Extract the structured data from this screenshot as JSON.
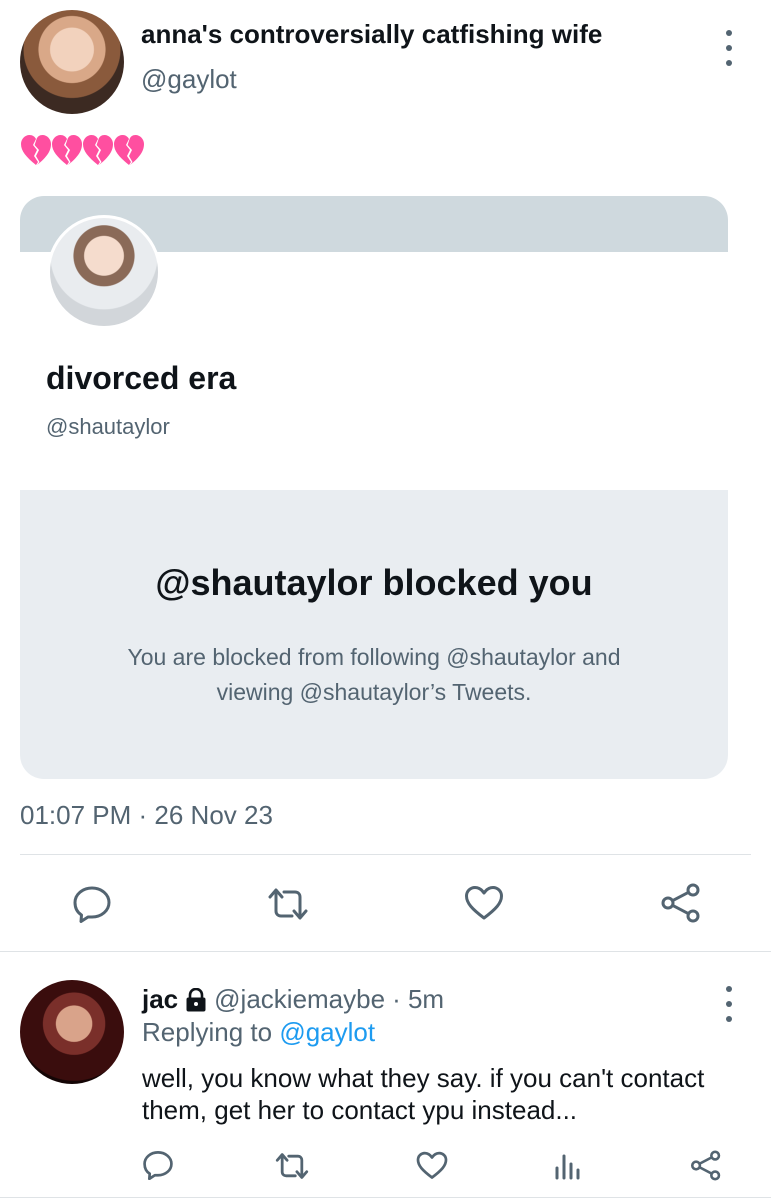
{
  "tweet": {
    "display_name": "anna's controversially catfishing wife",
    "handle": "@gaylot",
    "text": "💔💔💔💔",
    "timestamp": "01:07 PM · 26 Nov 23"
  },
  "quoted": {
    "display_name": "divorced era",
    "handle": "@shautaylor",
    "blocked_title": "@shautaylor blocked you",
    "blocked_description": "You are blocked from following @shautaylor and viewing @shautaylor’s Tweets."
  },
  "reply": {
    "display_name": "jac",
    "handle": "@jackiemaybe",
    "time": "· 5m",
    "replying_prefix": "Replying to",
    "replying_to": "@gaylot",
    "text": "well, you know what they say. if you can't contact them, get her to contact ypu instead..."
  },
  "colors": {
    "text_primary": "#0f1419",
    "text_secondary": "#536471",
    "link": "#1d9bf0",
    "blocked_box_bg": "#e9edf1",
    "banner_bg": "#cfd9de",
    "heart_pink": "#ff4fa0"
  },
  "icons": {
    "more": "more-vertical-icon",
    "reply": "reply-icon",
    "retweet": "retweet-icon",
    "like": "like-icon",
    "share": "share-icon",
    "views": "views-icon",
    "lock": "lock-icon"
  }
}
